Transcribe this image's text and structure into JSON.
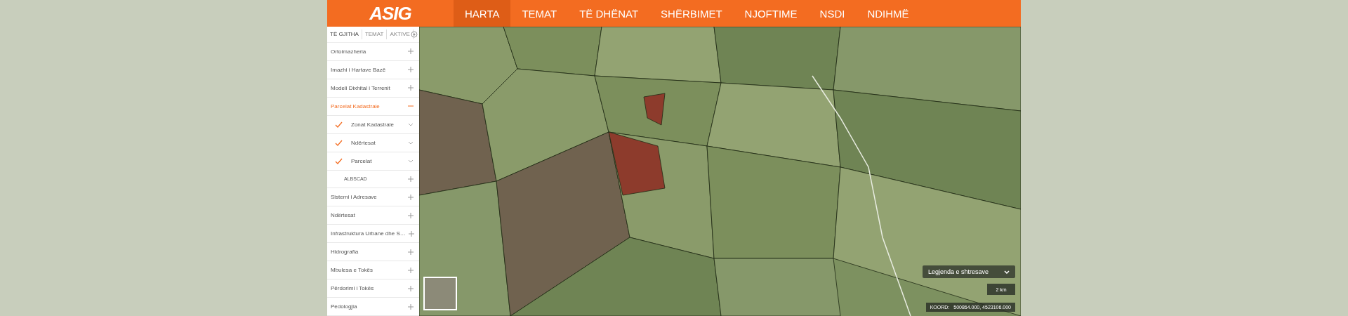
{
  "header": {
    "logo": "ASIG",
    "nav": [
      {
        "label": "HARTA",
        "selected": true
      },
      {
        "label": "TEMAT",
        "selected": false
      },
      {
        "label": "TË DHËNAT",
        "selected": false
      },
      {
        "label": "SHËRBIMET",
        "selected": false
      },
      {
        "label": "NJOFTIME",
        "selected": false
      },
      {
        "label": "NSDI",
        "selected": false
      },
      {
        "label": "NDIHMË",
        "selected": false
      }
    ]
  },
  "sidebar": {
    "tabs": [
      {
        "label": "TË GJITHA",
        "selected": true
      },
      {
        "label": "TEMAT",
        "selected": false
      },
      {
        "label": "AKTIVE",
        "selected": false
      }
    ],
    "layers": [
      {
        "kind": "group",
        "label": "Ortoimazheria",
        "expanded": false
      },
      {
        "kind": "group",
        "label": "Imazhi i Hartave Bazë",
        "expanded": false
      },
      {
        "kind": "group",
        "label": "Modeli Dixhital i Terrenit",
        "expanded": false
      },
      {
        "kind": "group",
        "label": "Parcelat Kadastrale",
        "expanded": true
      },
      {
        "kind": "layer",
        "label": "Zonat Kadastrale",
        "checked": true
      },
      {
        "kind": "layer",
        "label": "Ndërtesat",
        "checked": true
      },
      {
        "kind": "layer",
        "label": "Parcelat",
        "checked": true
      },
      {
        "kind": "subgroup",
        "label": "ALBSCAD",
        "expanded": false
      },
      {
        "kind": "group",
        "label": "Sistemi i Adresave",
        "expanded": false
      },
      {
        "kind": "group",
        "label": "Ndërtesat",
        "expanded": false
      },
      {
        "kind": "group",
        "label": "Infrastruktura Urbane dhe S…",
        "expanded": false
      },
      {
        "kind": "group",
        "label": "Hidrografia",
        "expanded": false
      },
      {
        "kind": "group",
        "label": "Mbulesa e Tokës",
        "expanded": false
      },
      {
        "kind": "group",
        "label": "Përdorimi i Tokës",
        "expanded": false
      },
      {
        "kind": "group",
        "label": "Pedologjia",
        "expanded": false
      }
    ]
  },
  "map": {
    "legend_button": "Legjenda e shtresave",
    "scale": "2 km",
    "coords_label": "KOORD:",
    "coords": "500864.000, 4523106.000"
  }
}
